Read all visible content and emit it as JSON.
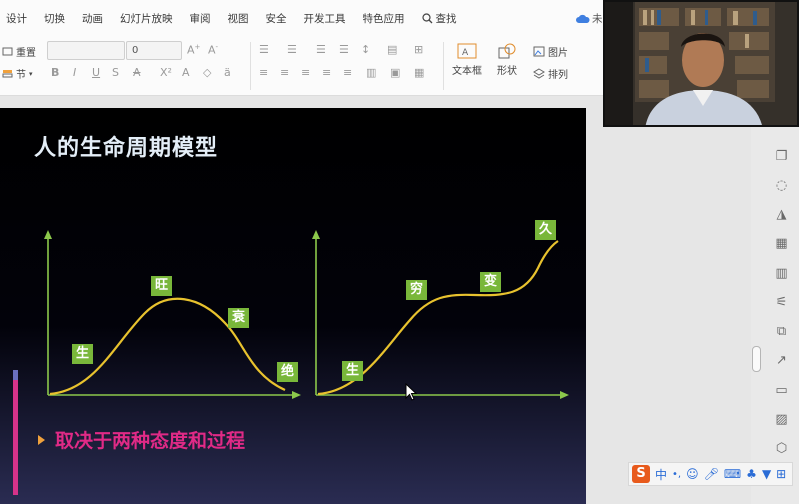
{
  "menu": {
    "items": [
      "设计",
      "切换",
      "动画",
      "幻灯片放映",
      "审阅",
      "视图",
      "安全",
      "开发工具",
      "特色应用"
    ],
    "search": "查找",
    "cloud": "未"
  },
  "ribbon": {
    "reset": "重置",
    "section": "节",
    "font_name": "",
    "font_size": "0",
    "textbox": "文本框",
    "shape": "形状",
    "picture": "图片",
    "arrange": "排列"
  },
  "slide": {
    "title": "人的生命周期模型",
    "conclusion": "取决于两种态度和过程",
    "left_labels": [
      "生",
      "旺",
      "衰",
      "绝"
    ],
    "right_labels": [
      "生",
      "穷",
      "变",
      "久"
    ]
  },
  "colors": {
    "accent_pink": "#e02a86",
    "label_green": "#79b73a",
    "axis_green": "#8cc84b",
    "curve_yellow": "#e8c22e"
  },
  "ime": {
    "mode": "中"
  }
}
